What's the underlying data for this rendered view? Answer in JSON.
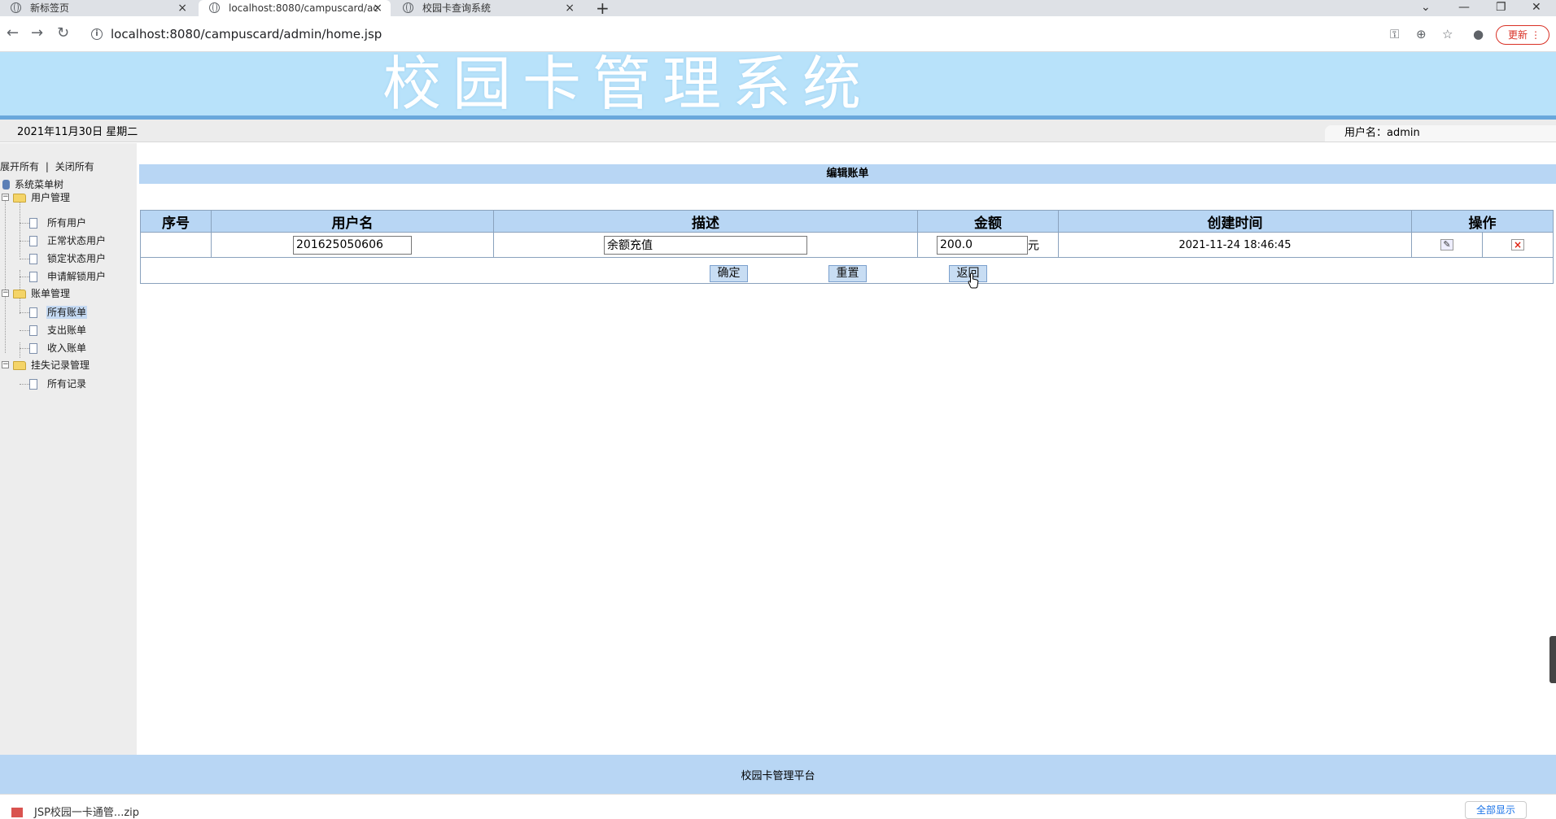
{
  "browser": {
    "tabs": [
      {
        "title": "新标签页",
        "close": "×"
      },
      {
        "title": "localhost:8080/campuscard/ac",
        "close": "×"
      },
      {
        "title": "校园卡查询系统",
        "close": "×"
      }
    ],
    "new_tab": "+",
    "url": "localhost:8080/campuscard/admin/home.jsp",
    "update_label": "更新"
  },
  "banner": {
    "title": "校园卡管理系统"
  },
  "infobar": {
    "date": "2021年11月30日 星期二",
    "user": "用户名：admin"
  },
  "sidebar": {
    "expand_all": "展开所有",
    "separator": "|",
    "collapse_all": "关闭所有",
    "root": "系统菜单树",
    "groups": [
      {
        "label": "用户管理",
        "items": [
          "所有用户",
          "正常状态用户",
          "锁定状态用户",
          "申请解锁用户"
        ]
      },
      {
        "label": "账单管理",
        "items": [
          "所有账单",
          "支出账单",
          "收入账单"
        ]
      },
      {
        "label": "挂失记录管理",
        "items": [
          "所有记录"
        ]
      }
    ],
    "active_item": "所有账单"
  },
  "main": {
    "header": "编辑账单",
    "columns": [
      "序号",
      "用户名",
      "描述",
      "金额",
      "创建时间",
      "操作"
    ],
    "row": {
      "index": "",
      "username": "201625050606",
      "description": "余额充值",
      "amount": "200.0",
      "unit": "元",
      "created": "2021-11-24 18:46:45"
    },
    "buttons": {
      "confirm": "确定",
      "reset": "重置",
      "back": "返回"
    }
  },
  "footer": {
    "text": "校园卡管理平台"
  },
  "download": {
    "filename": "JSP校园一卡通管...zip",
    "show_all": "全部显示"
  },
  "colors": {
    "banner": "#b8e2fa",
    "header": "#b8d6f4",
    "accent_line": "#6aa8dc"
  }
}
